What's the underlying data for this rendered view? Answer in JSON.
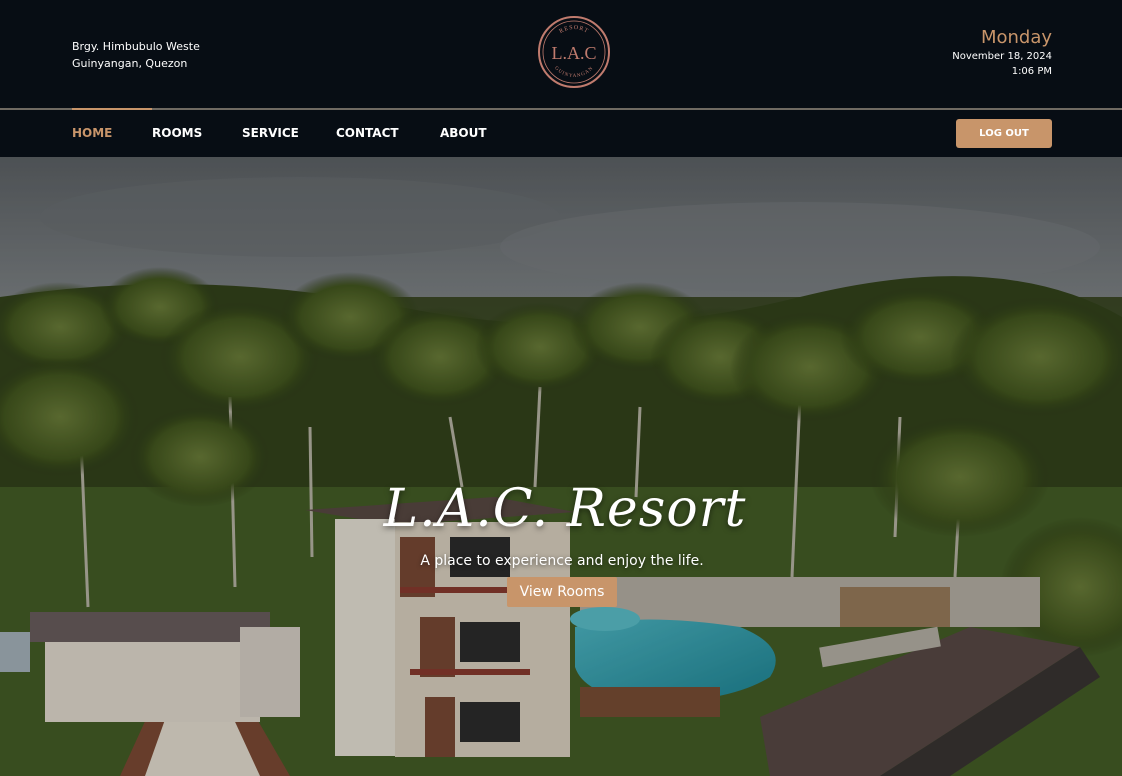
{
  "header": {
    "address_line1": "Brgy. Himbubulo Weste",
    "address_line2": "Guinyangan, Quezon",
    "logo_top_text": "RESORT",
    "logo_main_text": "L.A.C",
    "logo_bottom_text": "GUINYANGAN",
    "day": "Monday",
    "date": "November 18, 2024",
    "time": "1:06 PM"
  },
  "nav": {
    "items": [
      {
        "label": "HOME",
        "active": true
      },
      {
        "label": "ROOMS",
        "active": false
      },
      {
        "label": "SERVICE",
        "active": false
      },
      {
        "label": "CONTACT",
        "active": false
      },
      {
        "label": "ABOUT",
        "active": false
      }
    ],
    "logout_label": "LOG OUT"
  },
  "hero": {
    "title": "L.A.C. Resort",
    "subtitle": "A place to experience and enjoy the life.",
    "button_label": "View Rooms",
    "image": "aerial-photo-resort-palm-trees-pool"
  },
  "colors": {
    "background": "#070d14",
    "accent": "#c8956a",
    "divider": "#6f6a62"
  }
}
